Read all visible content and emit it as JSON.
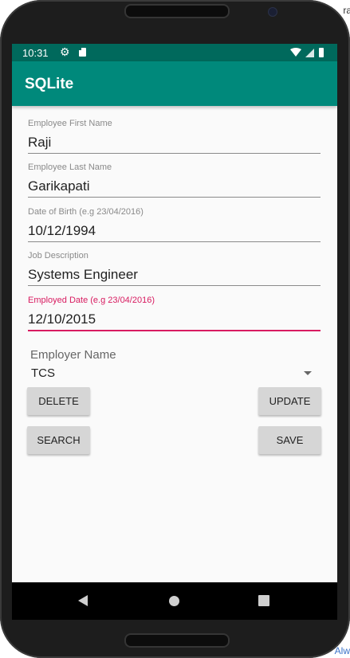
{
  "status_bar": {
    "time": "10:31",
    "icons": [
      "gear-icon",
      "sd-card-icon",
      "wifi-icon",
      "signal-icon",
      "battery-icon"
    ]
  },
  "app_bar": {
    "title": "SQLite"
  },
  "form": {
    "first_name": {
      "label": "Employee First Name",
      "value": "Raji"
    },
    "last_name": {
      "label": "Employee Last Name",
      "value": "Garikapati"
    },
    "dob": {
      "label": "Date of Birth (e.g 23/04/2016)",
      "value": "10/12/1994"
    },
    "job": {
      "label": "Job Description",
      "value": "Systems Engineer"
    },
    "employed": {
      "label": "Employed Date (e.g 23/04/2016)",
      "value": "12/10/2015"
    },
    "employer": {
      "label": "Employer Name",
      "selected": "TCS"
    }
  },
  "buttons": {
    "delete": "DELETE",
    "update": "UPDATE",
    "search": "SEARCH",
    "save": "SAVE"
  },
  "nav_bar": {
    "icons": [
      "back-icon",
      "home-icon",
      "recents-icon"
    ]
  },
  "background_text": {
    "top": "ra",
    "bottom": "Alw"
  },
  "colors": {
    "primary": "#00897b",
    "primary_dark": "#00695c",
    "accent": "#d81b60"
  }
}
